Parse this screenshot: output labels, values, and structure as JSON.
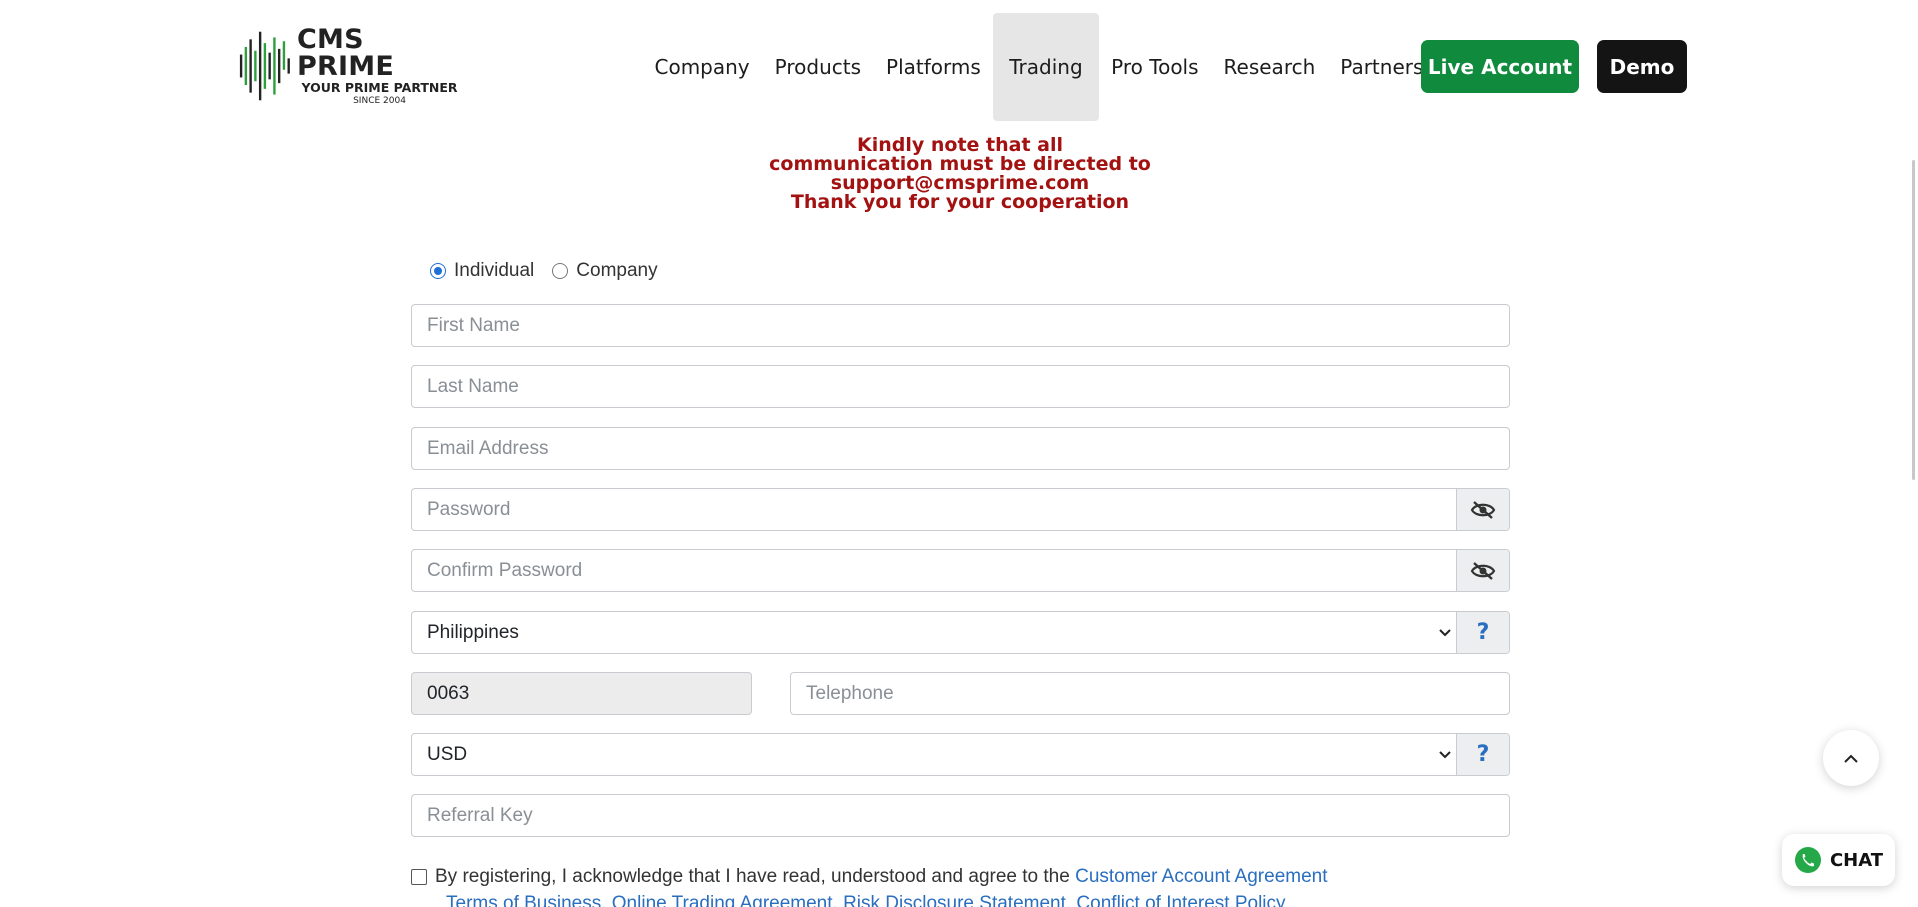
{
  "logo": {
    "name": "CMS PRIME",
    "tagline": "YOUR PRIME PARTNER",
    "since": "SINCE 2004"
  },
  "nav": {
    "items": [
      {
        "label": "Company"
      },
      {
        "label": "Products"
      },
      {
        "label": "Platforms"
      },
      {
        "label": "Trading"
      },
      {
        "label": "Pro Tools"
      },
      {
        "label": "Research"
      },
      {
        "label": "Partners"
      }
    ],
    "active": "Trading",
    "live_account": "Live Account",
    "demo": "Demo"
  },
  "notice": {
    "line1": "Kindly note that all",
    "line2": "communication must be directed to",
    "line3": "support@cmsprime.com",
    "line4": "Thank you for your cooperation"
  },
  "account_type": {
    "individual": "Individual",
    "company": "Company",
    "selected": "Individual"
  },
  "form": {
    "first_name": {
      "placeholder": "First Name",
      "value": ""
    },
    "last_name": {
      "placeholder": "Last Name",
      "value": ""
    },
    "email": {
      "placeholder": "Email Address",
      "value": ""
    },
    "password": {
      "placeholder": "Password",
      "value": ""
    },
    "confirm_password": {
      "placeholder": "Confirm Password",
      "value": ""
    },
    "country": {
      "selected": "Philippines"
    },
    "phone_code": "0063",
    "telephone": {
      "placeholder": "Telephone",
      "value": ""
    },
    "currency": {
      "selected": "USD"
    },
    "referral_key": {
      "placeholder": "Referral Key",
      "value": ""
    },
    "help_symbol": "?"
  },
  "agreement": {
    "text": "By registering, I acknowledge that I have read, understood and agree to the ",
    "link1": "Customer Account Agreement",
    "links_line2": "Terms of Business, Online Trading Agreement, Risk Disclosure Statement, Conflict of Interest Policy"
  },
  "chat": {
    "label": "CHAT"
  },
  "colors": {
    "brand_green": "#108a3c",
    "notice_red": "#a31111",
    "link_blue": "#2a6ebf",
    "dark": "#141414"
  }
}
